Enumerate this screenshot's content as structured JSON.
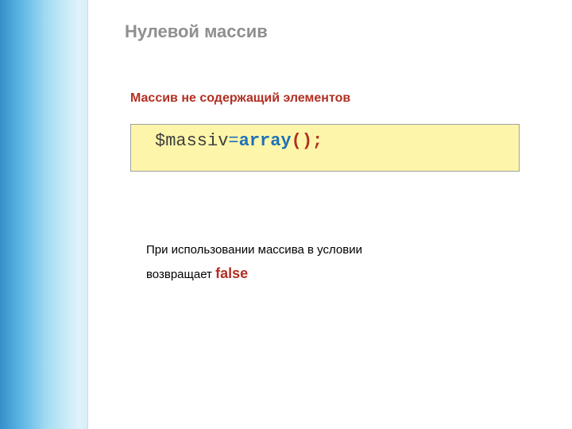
{
  "slide": {
    "title": "Нулевой массив",
    "subtitle": "Массив не содержащий элементов"
  },
  "code": {
    "variable": "$massiv",
    "assign": "=",
    "keyword": "array",
    "open_paren": "(",
    "close_paren_semi": ");"
  },
  "note": {
    "line1": "При использовании массива в условии",
    "line2_prefix": "возвращает ",
    "false_word": "false"
  }
}
